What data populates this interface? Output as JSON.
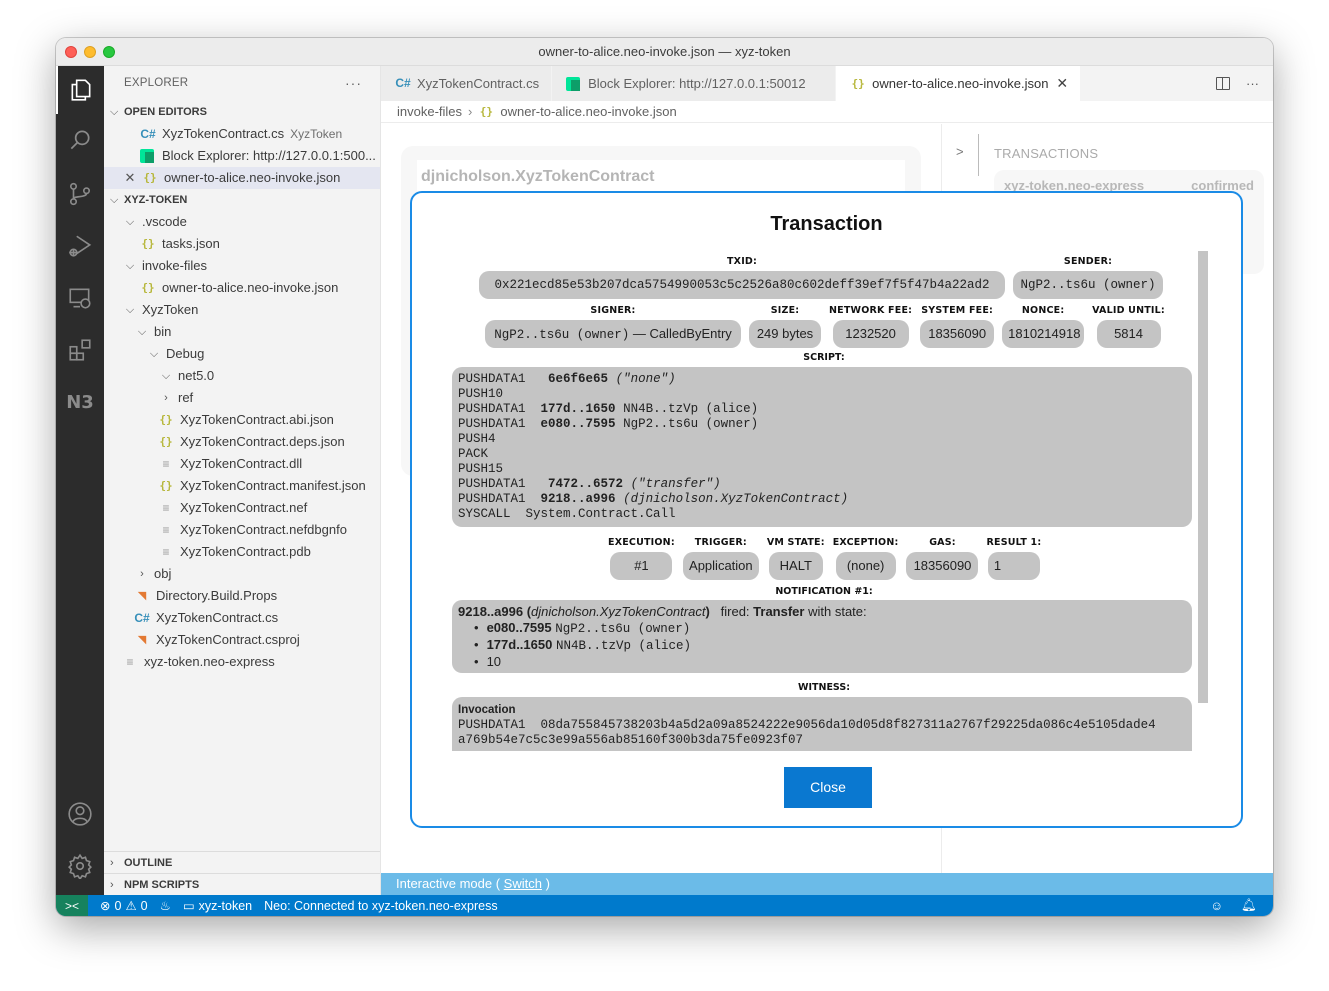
{
  "window": {
    "title": "owner-to-alice.neo-invoke.json — xyz-token"
  },
  "activity_bar": {
    "items": [
      "explorer-icon",
      "search-icon",
      "source-control-icon",
      "run-debug-icon",
      "remote-explorer-icon",
      "extensions-icon",
      "neo-n3-icon"
    ],
    "n3_label": "N3",
    "bottom": [
      "account-icon",
      "settings-gear-icon"
    ]
  },
  "sidebar": {
    "title": "EXPLORER",
    "more": "···",
    "open_editors": {
      "label": "OPEN EDITORS",
      "items": [
        {
          "icon": "csharp-icon",
          "name": "XyzTokenContract.cs",
          "desc": "XyzToken"
        },
        {
          "icon": "neo-icon",
          "name": "Block Explorer: http://127.0.0.1:500..."
        },
        {
          "icon": "json-icon",
          "name": "owner-to-alice.neo-invoke.json",
          "selected": true
        }
      ]
    },
    "workspace": {
      "label": "XYZ-TOKEN",
      "tree": [
        {
          "name": ".vscode",
          "type": "folder",
          "expanded": true
        },
        {
          "name": "tasks.json",
          "type": "json"
        },
        {
          "name": "invoke-files",
          "type": "folder",
          "expanded": true
        },
        {
          "name": "owner-to-alice.neo-invoke.json",
          "type": "json"
        },
        {
          "name": "XyzToken",
          "type": "folder",
          "expanded": true
        },
        {
          "name": "bin",
          "type": "folder",
          "expanded": true
        },
        {
          "name": "Debug",
          "type": "folder",
          "expanded": true
        },
        {
          "name": "net5.0",
          "type": "folder",
          "expanded": true
        },
        {
          "name": "ref",
          "type": "folder",
          "expanded": false
        },
        {
          "name": "XyzTokenContract.abi.json",
          "type": "json"
        },
        {
          "name": "XyzTokenContract.deps.json",
          "type": "json"
        },
        {
          "name": "XyzTokenContract.dll",
          "type": "file"
        },
        {
          "name": "XyzTokenContract.manifest.json",
          "type": "json"
        },
        {
          "name": "XyzTokenContract.nef",
          "type": "file"
        },
        {
          "name": "XyzTokenContract.nefdbgnfo",
          "type": "file"
        },
        {
          "name": "XyzTokenContract.pdb",
          "type": "file"
        },
        {
          "name": "obj",
          "type": "folder",
          "expanded": false
        },
        {
          "name": "Directory.Build.Props",
          "type": "rss"
        },
        {
          "name": "XyzTokenContract.cs",
          "type": "csharp"
        },
        {
          "name": "XyzTokenContract.csproj",
          "type": "rss"
        },
        {
          "name": "xyz-token.neo-express",
          "type": "file"
        }
      ]
    },
    "outline": "OUTLINE",
    "npm_scripts": "NPM SCRIPTS"
  },
  "tabs": [
    {
      "label": "XyzTokenContract.cs",
      "icon": "csharp-icon"
    },
    {
      "label": "Block Explorer: http://127.0.0.1:50012",
      "icon": "neo-icon"
    },
    {
      "label": "owner-to-alice.neo-invoke.json",
      "icon": "json-icon",
      "active": true
    }
  ],
  "breadcrumb": {
    "folder": "invoke-files",
    "file": "owner-to-alice.neo-invoke.json"
  },
  "background": {
    "contract_name": "djnicholson.XyzTokenContract",
    "transactions_title": "TRANSACTIONS",
    "tx_card_left": "xyz-token.neo-express",
    "tx_card_right": "confirmed"
  },
  "modal": {
    "title": "Transaction",
    "txid_label": "TXID:",
    "txid": "0x221ecd85e53b207dca5754990053c5c2526a80c602deff39ef7f5f47b4a22ad2",
    "sender_label": "SENDER:",
    "sender": "NgP2..ts6u (owner)",
    "signer_label": "SIGNER:",
    "signer_addr": "NgP2..ts6u (owner)",
    "signer_scope": " — CalledByEntry",
    "size_label": "SIZE:",
    "size": "249 bytes",
    "network_fee_label": "NETWORK FEE:",
    "network_fee": "1232520",
    "system_fee_label": "SYSTEM FEE:",
    "system_fee": "18356090",
    "nonce_label": "NONCE:",
    "nonce": "1810214918",
    "valid_until_label": "VALID UNTIL:",
    "valid_until": "5814",
    "script_label": "SCRIPT:",
    "script": [
      {
        "op": "PUSHDATA1",
        "arg": "6e6f6e65",
        "note": "(\"none\")"
      },
      {
        "op": "PUSH10"
      },
      {
        "op": "PUSHDATA1",
        "arg": "177d..1650",
        "note": "NN4B..tzVp (alice)"
      },
      {
        "op": "PUSHDATA1",
        "arg": "e080..7595",
        "note": "NgP2..ts6u (owner)"
      },
      {
        "op": "PUSH4"
      },
      {
        "op": "PACK"
      },
      {
        "op": "PUSH15"
      },
      {
        "op": "PUSHDATA1",
        "arg": "7472..6572",
        "note": "(\"transfer\")"
      },
      {
        "op": "PUSHDATA1",
        "arg": "9218..a996",
        "note": "(djnicholson.XyzTokenContract)"
      },
      {
        "op": "SYSCALL",
        "arg": "System.Contract.Call"
      }
    ],
    "execution_label": "EXECUTION:",
    "execution": "#1",
    "trigger_label": "TRIGGER:",
    "trigger": "Application",
    "vm_state_label": "VM STATE:",
    "vm_state": "HALT",
    "exception_label": "EXCEPTION:",
    "exception": "(none)",
    "gas_label": "GAS:",
    "gas": "18356090",
    "result_label": "RESULT 1:",
    "result": "1",
    "notification_label": "NOTIFICATION #1:",
    "notification": {
      "contract_hash": "9218..a996",
      "contract_name": "djnicholson.XyzTokenContract",
      "fired": "fired:",
      "event": "Transfer",
      "with_state": "with state:",
      "state": [
        {
          "hash": "e080..7595",
          "addr": "NgP2..ts6u (owner)"
        },
        {
          "hash": "177d..1650",
          "addr": "NN4B..tzVp (alice)"
        },
        {
          "value": "10"
        }
      ]
    },
    "witness_label": "WITNESS:",
    "witness": {
      "heading": "Invocation",
      "line1": "PUSHDATA1  08da755845738203b4a5d2a09a8524222e9056da10d05d8f827311a2767f29225da086c4e5105dade4",
      "line2": "a769b54e7c5c3e99a556ab85160f300b3da75fe0923f07"
    },
    "close_label": "Close"
  },
  "interactive_bar": {
    "prefix": "Interactive mode ( ",
    "link": "Switch",
    "suffix": " )"
  },
  "status_bar": {
    "errors": "0",
    "warnings": "0",
    "folder": "xyz-token",
    "neo_status": "Neo: Connected to xyz-token.neo-express"
  }
}
